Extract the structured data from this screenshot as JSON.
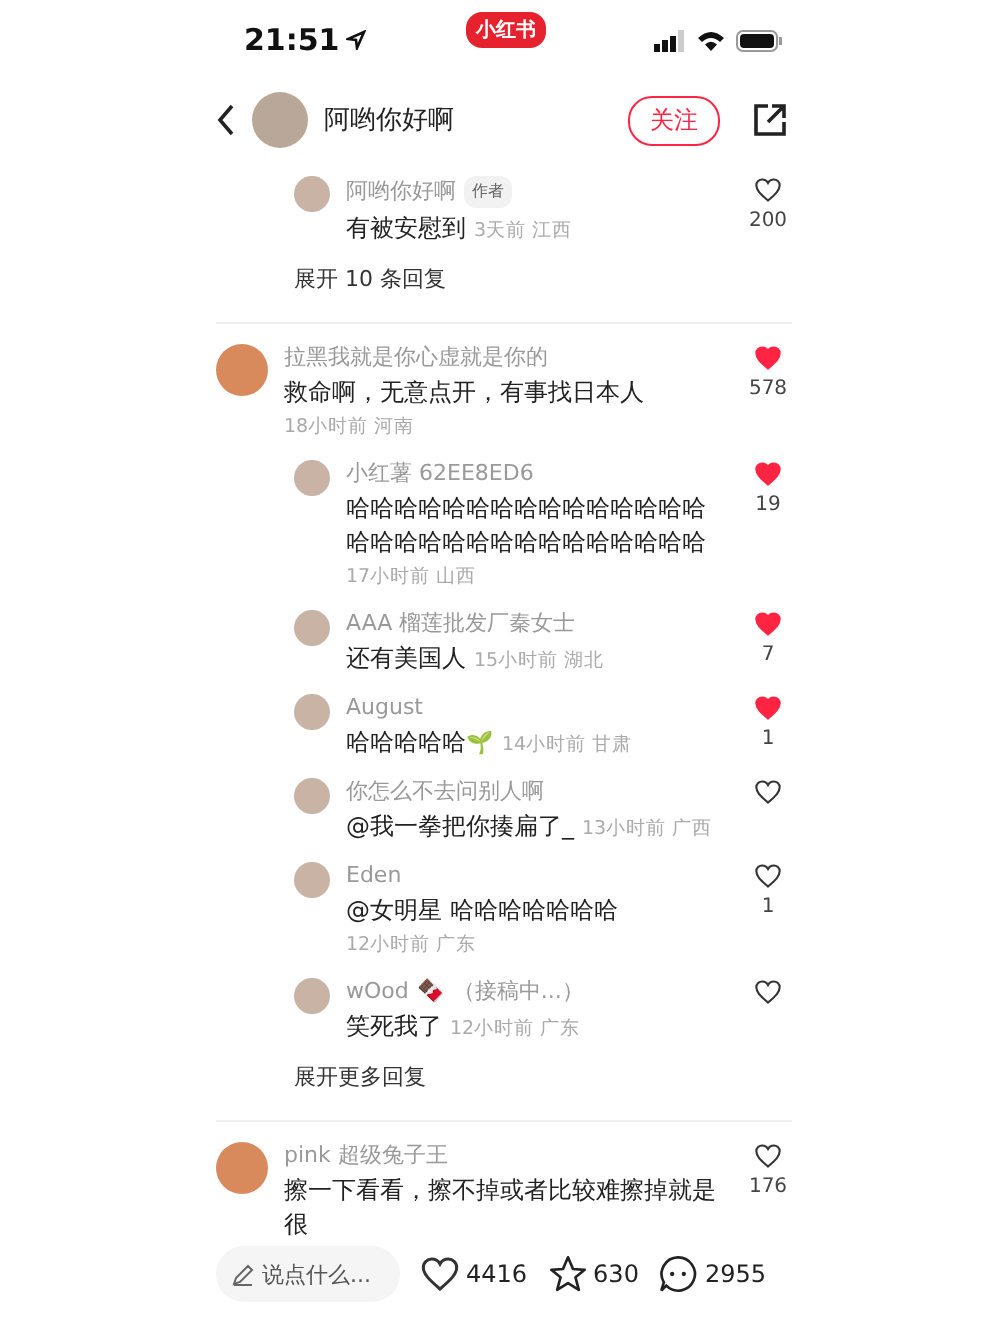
{
  "status_bar": {
    "time": "21:51",
    "app_badge": "小红书"
  },
  "header": {
    "author": "阿哟你好啊",
    "follow_button": "关注"
  },
  "threads": [
    {
      "replies": [
        {
          "name": "阿哟你好啊",
          "tag": "作者",
          "text": "有被安慰到",
          "meta": "3天前 江西",
          "meta_inline": true,
          "liked": false,
          "likes": "200"
        }
      ],
      "expand_link": "展开 10 条回复"
    },
    {
      "comment": {
        "name": "拉黑我就是你心虚就是你的",
        "text": "救命啊，无意点开，有事找日本人",
        "meta": "18小时前 河南",
        "meta_inline": false,
        "liked": true,
        "likes": "578"
      },
      "replies": [
        {
          "name": "小红薯 62EE8ED6",
          "text": "哈哈哈哈哈哈哈哈哈哈哈哈哈哈哈哈哈哈哈哈哈哈哈哈哈哈哈哈哈哈",
          "meta": "17小时前 山西",
          "meta_inline": false,
          "liked": true,
          "likes": "19"
        },
        {
          "name": "AAA 榴莲批发厂秦女士",
          "text": "还有美国人",
          "meta": "15小时前 湖北",
          "meta_inline": true,
          "liked": true,
          "likes": "7"
        },
        {
          "name": "August",
          "text": "哈哈哈哈哈",
          "text_emoji": "🌱",
          "meta": "14小时前 甘肃",
          "meta_inline": true,
          "liked": true,
          "likes": "1"
        },
        {
          "name": "你怎么不去问别人啊",
          "text": "@我一拳把你揍扁了_",
          "meta": "13小时前 广西",
          "meta_inline": true,
          "liked": false
        },
        {
          "name": "Eden",
          "text": "@女明星 哈哈哈哈哈哈哈",
          "meta": "12小时前 广东",
          "meta_inline": false,
          "liked": false,
          "likes": "1"
        },
        {
          "name": "wOod",
          "name_emoji": "🍫",
          "name_note": "（接稿中...）",
          "text": "笑死我了",
          "meta": "12小时前 广东",
          "meta_inline": true,
          "liked": false
        }
      ],
      "expand_link": "展开更多回复"
    },
    {
      "comment": {
        "name": "pink 超级兔子王",
        "text": "擦一下看看，擦不掉或者比较难擦掉就是很",
        "liked": false,
        "likes": "176"
      }
    }
  ],
  "bottom_bar": {
    "placeholder": "说点什么...",
    "likes": "4416",
    "stars": "630",
    "comments": "2955"
  }
}
